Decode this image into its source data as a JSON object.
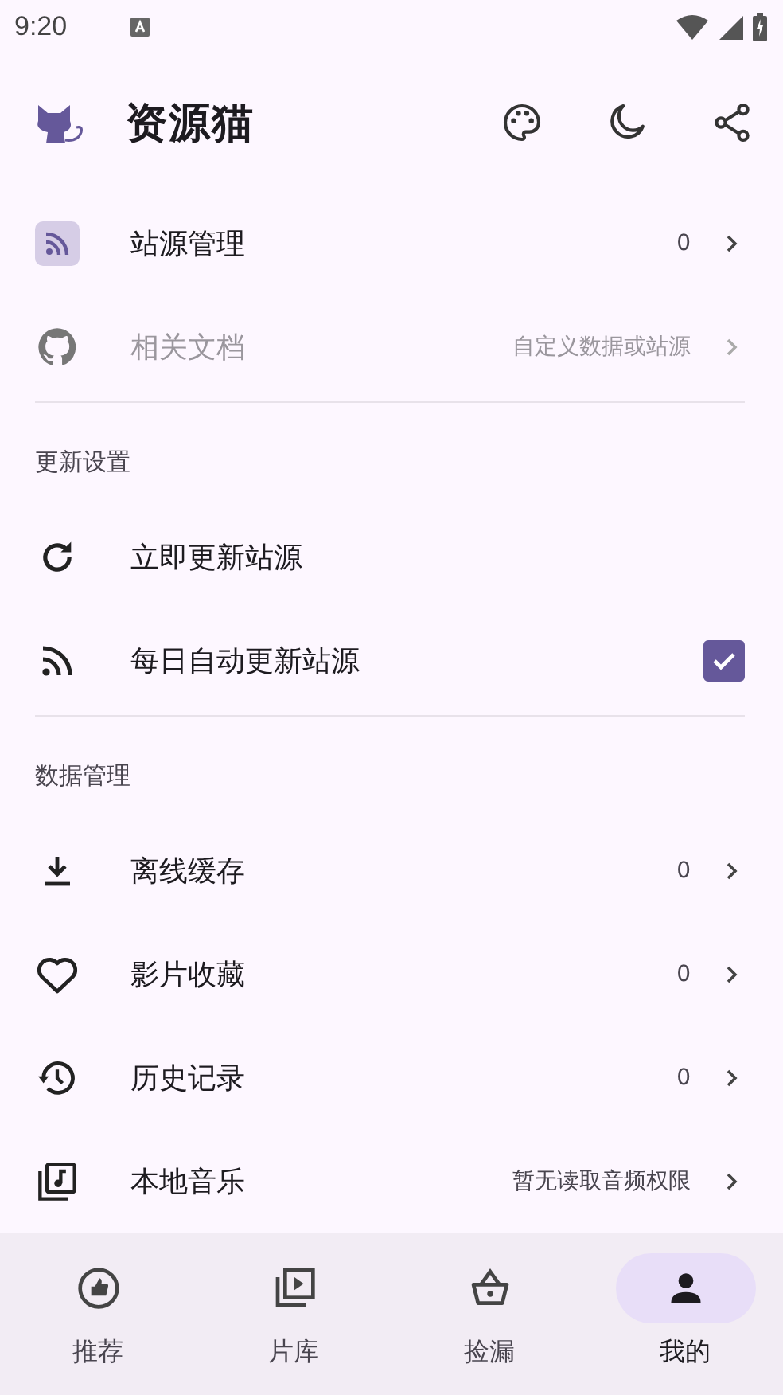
{
  "status_bar": {
    "time": "9:20"
  },
  "app_bar": {
    "title": "资源猫"
  },
  "sections": [
    {
      "items": [
        {
          "kind": "link",
          "label": "站源管理",
          "value": "0",
          "disabled": false
        },
        {
          "kind": "link",
          "label": "相关文档",
          "value": "自定义数据或站源",
          "disabled": true
        }
      ]
    },
    {
      "header": "更新设置",
      "items": [
        {
          "kind": "action",
          "label": "立即更新站源",
          "disabled": false
        },
        {
          "kind": "checkbox",
          "label": "每日自动更新站源",
          "checked": true,
          "disabled": false
        }
      ]
    },
    {
      "header": "数据管理",
      "items": [
        {
          "kind": "link",
          "label": "离线缓存",
          "value": "0",
          "disabled": false
        },
        {
          "kind": "link",
          "label": "影片收藏",
          "value": "0",
          "disabled": false
        },
        {
          "kind": "link",
          "label": "历史记录",
          "value": "0",
          "disabled": false
        },
        {
          "kind": "link",
          "label": "本地音乐",
          "value": "暂无读取音频权限",
          "disabled": false
        }
      ]
    }
  ],
  "bottom_nav": [
    {
      "label": "推荐",
      "selected": false
    },
    {
      "label": "片库",
      "selected": false
    },
    {
      "label": "捡漏",
      "selected": false
    },
    {
      "label": "我的",
      "selected": true
    }
  ]
}
